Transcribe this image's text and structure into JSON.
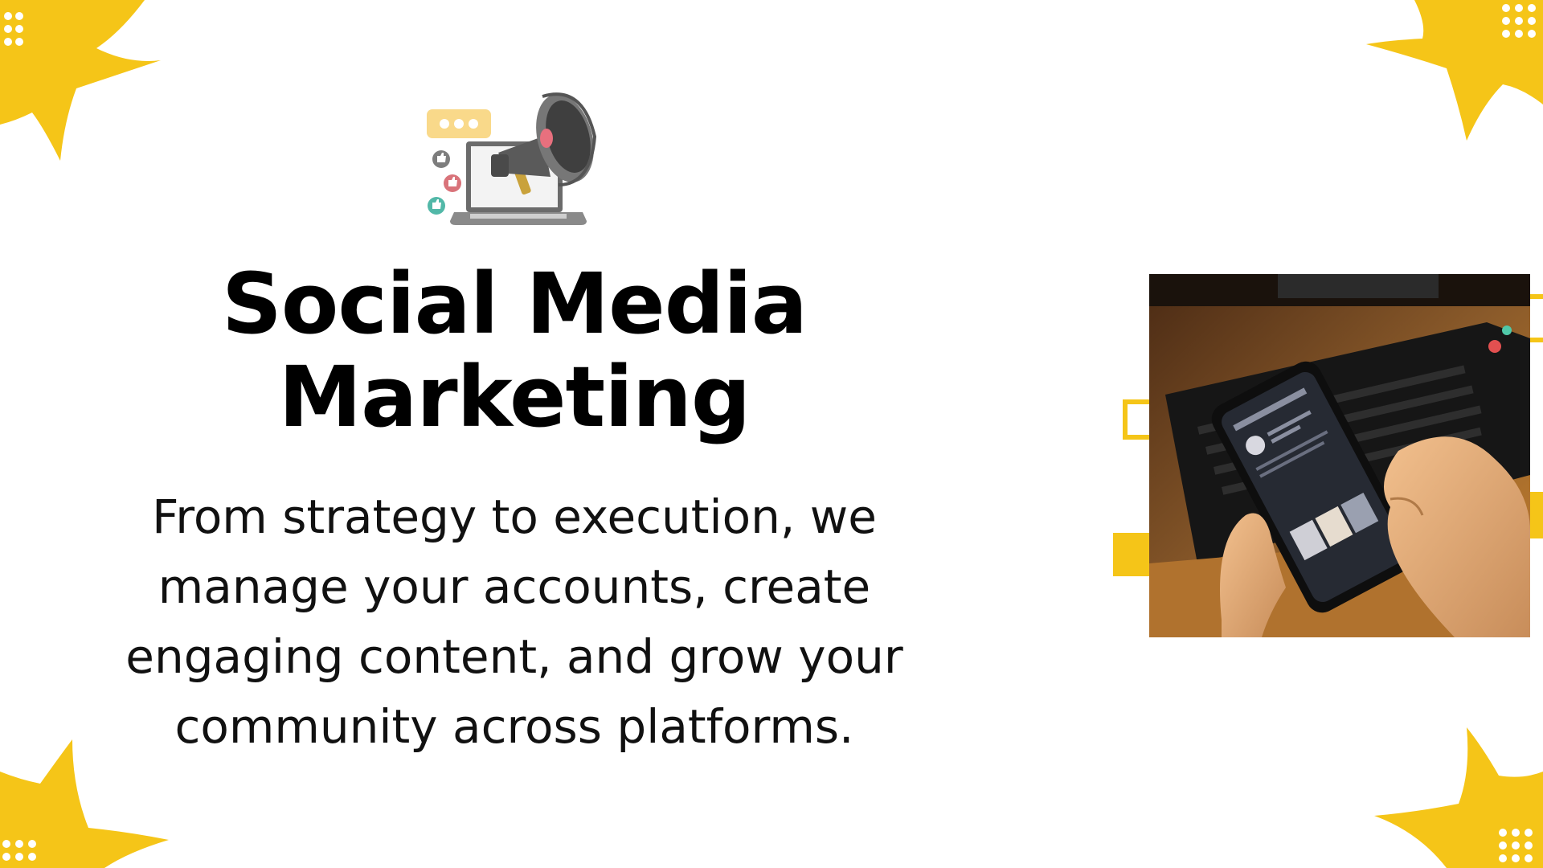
{
  "slide": {
    "title_lines": [
      "Social Media",
      "Marketing"
    ],
    "body_lines": [
      "From strategy to execution, we",
      "manage your accounts, create",
      "engaging content, and grow your",
      "community across platforms."
    ]
  },
  "icons": {
    "hero": "megaphone-laptop-icon",
    "chat": "chat-bubble-icon",
    "likes": [
      "thumbs-up-icon",
      "thumbs-up-icon",
      "thumbs-up-icon"
    ]
  },
  "photo": {
    "subject": "hands-holding-smartphone-photo"
  },
  "colors": {
    "accent": "#F5C518",
    "background": "#FFFFFF",
    "text": "#000000"
  }
}
